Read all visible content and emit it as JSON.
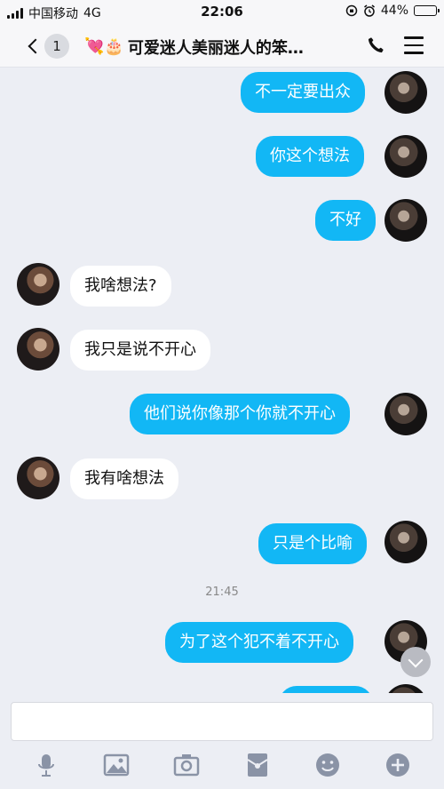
{
  "status_bar": {
    "carrier": "中国移动",
    "network": "4G",
    "time": "22:06",
    "battery": "44%",
    "battery_level": 0.44
  },
  "nav": {
    "unread_count": "1",
    "title_icons": "💘🎂",
    "title": "可爱迷人美丽迷人的笨…"
  },
  "messages": [
    {
      "side": "out",
      "text": "不一定要出众"
    },
    {
      "side": "out",
      "text": "你这个想法"
    },
    {
      "side": "out",
      "text": "不好"
    },
    {
      "side": "in",
      "text": "我啥想法?"
    },
    {
      "side": "in",
      "text": "我只是说不开心"
    },
    {
      "side": "out",
      "text": "他们说你像那个你就不开心"
    },
    {
      "side": "in",
      "text": "我有啥想法"
    },
    {
      "side": "out",
      "text": "只是个比喻"
    },
    {
      "side": "out",
      "text": "为了这个犯不着不开心"
    }
  ],
  "timestamp": "21:45",
  "toolbar": [
    "mic-icon",
    "image-icon",
    "camera-icon",
    "red-packet-icon",
    "emoji-icon",
    "plus-icon"
  ],
  "colors": {
    "outgoing_bubble": "#12b7f5",
    "incoming_bubble": "#ffffff",
    "background": "#eceef4",
    "toolbar_icon": "#8a93a6"
  }
}
